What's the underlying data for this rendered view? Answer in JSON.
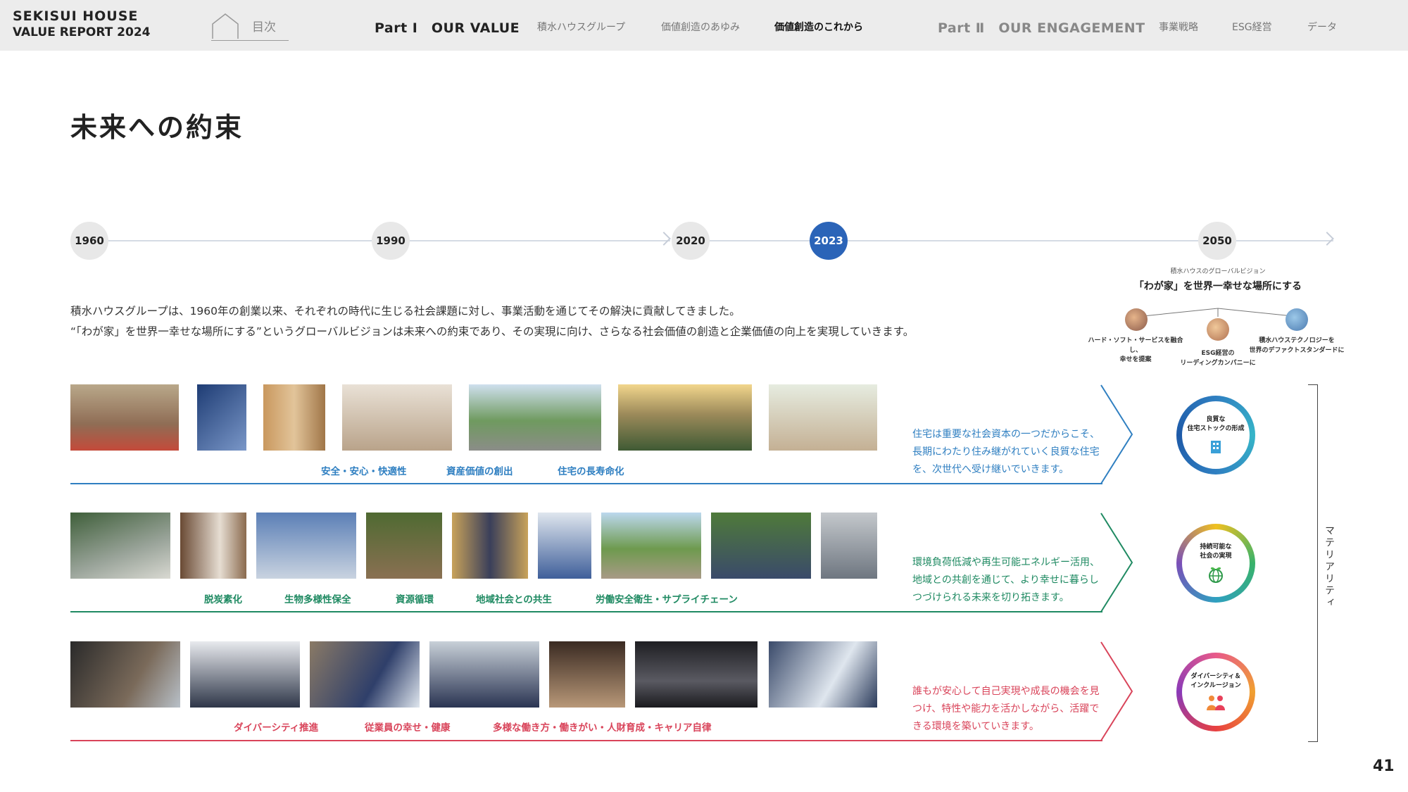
{
  "header": {
    "brand_line1": "SEKISUI HOUSE",
    "brand_line2": "VALUE REPORT 2024",
    "toc_label": "目次",
    "part1": "Part Ⅰ　OUR VALUE",
    "part1_items": [
      "積水ハウスグループ",
      "価値創造のあゆみ",
      "価値創造のこれから"
    ],
    "part1_active_index": 2,
    "part2": "Part Ⅱ　OUR ENGAGEMENT",
    "part2_items": [
      "事業戦略",
      "ESG経営",
      "データ"
    ]
  },
  "title": "未来への約束",
  "timeline": {
    "years": [
      "1960",
      "1990",
      "2020",
      "2023",
      "2050"
    ],
    "current": "2023"
  },
  "vision": {
    "caption": "積水ハウスのグローバルビジョン",
    "title": "「わが家」を世界一幸せな場所にする",
    "left": "ハード・ソフト・サービスを融合し、\n幸せを提案",
    "center": "ESG経営の\nリーディングカンパニーに",
    "right": "積水ハウステクノロジーを\n世界のデファクトスタンダードに"
  },
  "intro": {
    "line1": "積水ハウスグループは、1960年の創業以来、それぞれの時代に生じる社会課題に対し、事業活動を通じてその解決に貢献してきました。",
    "line2": "“「わが家」を世界一幸せな場所にする”というグローバルビジョンは未来への約束であり、その実現に向け、さらなる社会価値の創造と企業価値の向上を実現していきます。"
  },
  "rows": [
    {
      "color": "#2f7fc1",
      "labels": [
        "安全・安心・快適性",
        "資産価値の創出",
        "住宅の長寿命化"
      ],
      "text": "住宅は重要な社会資本の一つだからこそ、長期にわたり住み継がれていく良質な住宅を、次世代へ受け継いでいきます。",
      "circle_label": "良質な\n住宅ストックの形成",
      "icon": "building-icon"
    },
    {
      "color": "#1f8a62",
      "labels": [
        "脱炭素化",
        "生物多様性保全",
        "資源循環",
        "地域社会との共生",
        "労働安全衛生・サプライチェーン"
      ],
      "text": "環境負荷低減や再生可能エネルギー活用、地域との共創を通じて、より幸せに暮らしつづけられる未来を切り拓きます。",
      "circle_label": "持続可能な\n社会の実現",
      "icon": "globe-sprout-icon"
    },
    {
      "color": "#d9445a",
      "labels": [
        "ダイバーシティ推進",
        "従業員の幸せ・健康",
        "多様な働き方・働きがい・人財育成・キャリア自律"
      ],
      "text": "誰もが安心して自己実現や成長の機会を見つけ、特性や能力を活かしながら、活躍できる環境を築いていきます。",
      "circle_label": "ダイバーシティ＆\nインクルージョン",
      "icon": "people-icon"
    }
  ],
  "materiality_label": "マテリアリティ",
  "page_number": "41",
  "colors": {
    "timeline_current": "#2b64b8",
    "row1": "#2f7fc1",
    "row2": "#1f8a62",
    "row3": "#d9445a"
  }
}
